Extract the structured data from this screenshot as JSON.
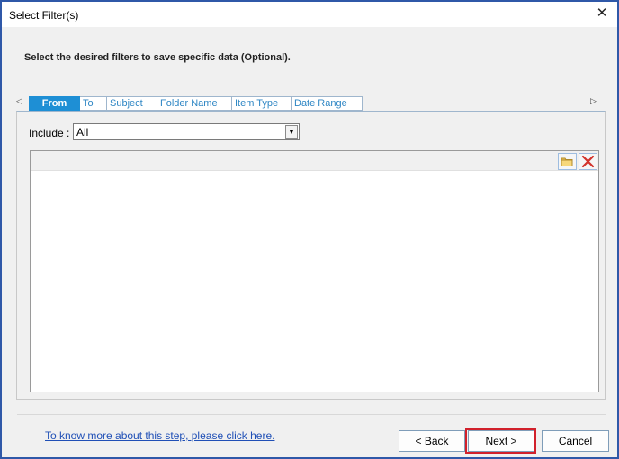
{
  "window": {
    "title": "Select Filter(s)"
  },
  "instruction": "Select the desired filters to save specific data (Optional).",
  "tabs": [
    {
      "label": "From",
      "active": true
    },
    {
      "label": "To",
      "active": false
    },
    {
      "label": "Subject",
      "active": false
    },
    {
      "label": "Folder Name",
      "active": false
    },
    {
      "label": "Item Type",
      "active": false
    },
    {
      "label": "Date Range",
      "active": false
    }
  ],
  "include": {
    "label": "Include :",
    "value": "All"
  },
  "help_link": "To know more about this step, please click here.",
  "buttons": {
    "back": "Back",
    "next": "Next",
    "cancel": "Cancel"
  },
  "colors": {
    "accent": "#1e8fd5",
    "highlight": "#d1202b",
    "link": "#1f4fb6",
    "border": "#2f58a8"
  },
  "icons": [
    "close-icon",
    "tab-scroll-left-icon",
    "tab-scroll-right-icon",
    "dropdown-arrow-icon",
    "folder-icon",
    "delete-icon"
  ]
}
